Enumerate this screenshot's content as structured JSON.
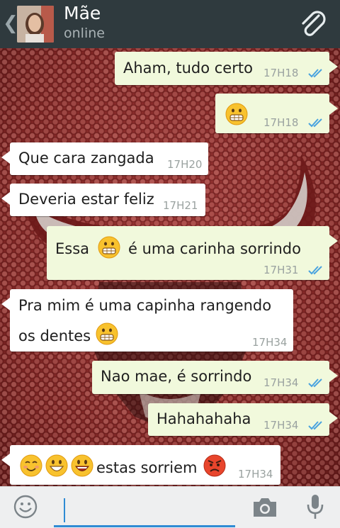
{
  "header": {
    "contact_name": "Mãe",
    "status": "online"
  },
  "icons": {
    "back": "chevron-left-icon",
    "attach": "paperclip-icon",
    "emoji": "smiley-icon",
    "camera": "camera-icon",
    "mic": "microphone-icon"
  },
  "colors": {
    "header_bg": "#2f3a3e",
    "outgoing_bubble": "#f1f9dc",
    "incoming_bubble": "#ffffff",
    "read_ticks": "#4aa3df"
  },
  "messages": [
    {
      "direction": "out",
      "text": "Aham, tudo certo",
      "time": "17H18",
      "read": true
    },
    {
      "direction": "out",
      "text": "",
      "emoji": [
        "grin"
      ],
      "time": "17H18",
      "read": true
    },
    {
      "direction": "in",
      "text": "Que cara zangada",
      "time": "17H20"
    },
    {
      "direction": "in",
      "text": "Deveria estar feliz",
      "time": "17H21"
    },
    {
      "direction": "out",
      "text_before": "Essa",
      "text_after": "é uma carinha sorrindo",
      "emoji": [
        "grin"
      ],
      "time": "17H31",
      "read": true
    },
    {
      "direction": "in",
      "line1": "Pra mim é uma capinha rangendo",
      "line2": "os dentes",
      "emoji": [
        "grin"
      ],
      "time": "17H34"
    },
    {
      "direction": "out",
      "text": "Nao mae, é sorrindo",
      "time": "17H34",
      "read": true
    },
    {
      "direction": "out",
      "text": "Hahahahaha",
      "time": "17H34",
      "read": true
    },
    {
      "direction": "in",
      "text": "estas sorriem",
      "emoji_before": [
        "blush",
        "grinning",
        "smiley"
      ],
      "emoji_after": [
        "angry"
      ],
      "time": "17H34"
    }
  ]
}
